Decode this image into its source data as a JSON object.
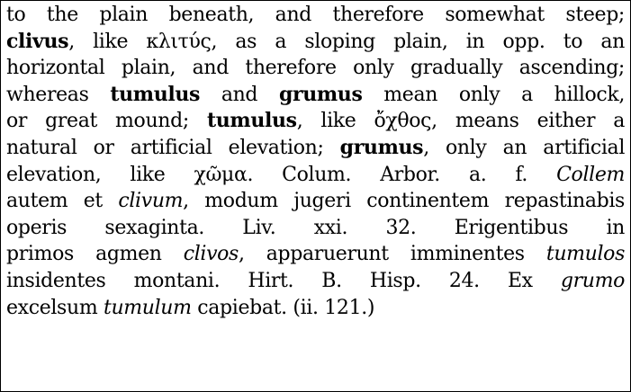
{
  "lines": [
    [
      {
        "t": "to the plain beneath, and therefore somewhat steep;",
        "s": "n"
      }
    ],
    [
      {
        "t": "clivus",
        "s": "b"
      },
      {
        "t": ", like κλιτύς, as a sloping plain, in opp.  to an",
        "s": "n"
      }
    ],
    [
      {
        "t": "horizontal plain, and therefore only gradually ascending;",
        "s": "n"
      }
    ],
    [
      {
        "t": "whereas ",
        "s": "n"
      },
      {
        "t": "tumulus",
        "s": "b"
      },
      {
        "t": " and ",
        "s": "n"
      },
      {
        "t": "grumus",
        "s": "b"
      },
      {
        "t": " mean only a hillock,",
        "s": "n"
      }
    ],
    [
      {
        "t": "or great mound; ",
        "s": "n"
      },
      {
        "t": "tumulus",
        "s": "b"
      },
      {
        "t": ", like ὄχθος, means either a",
        "s": "n"
      }
    ],
    [
      {
        "t": "natural or artificial elevation; ",
        "s": "n"
      },
      {
        "t": "grumus",
        "s": "b"
      },
      {
        "t": ", only an artificial",
        "s": "n"
      }
    ],
    [
      {
        "t": "elevation, like χῶμα. Colum. Arbor. a. f. ",
        "s": "n"
      },
      {
        "t": "Collem",
        "s": "i"
      }
    ],
    [
      {
        "t": "autem et ",
        "s": "n"
      },
      {
        "t": "clivum",
        "s": "i"
      },
      {
        "t": ", modum jugeri continentem repastinabis",
        "s": "n"
      }
    ],
    [
      {
        "t": "operis sexaginta. Liv. xxi. 32. Erigentibus in",
        "s": "n"
      }
    ],
    [
      {
        "t": "primos agmen ",
        "s": "n"
      },
      {
        "t": "clivos",
        "s": "i"
      },
      {
        "t": ", apparuerunt imminentes ",
        "s": "n"
      },
      {
        "t": "tumulos",
        "s": "i"
      }
    ],
    [
      {
        "t": "insidentes montani. Hirt. B. Hisp. 24. Ex ",
        "s": "n"
      },
      {
        "t": "grumo",
        "s": "i"
      }
    ],
    [
      {
        "t": "excelsum ",
        "s": "n"
      },
      {
        "t": "tumulum",
        "s": "i"
      },
      {
        "t": " capiebat. (ii. 121.)",
        "s": "n"
      }
    ]
  ]
}
